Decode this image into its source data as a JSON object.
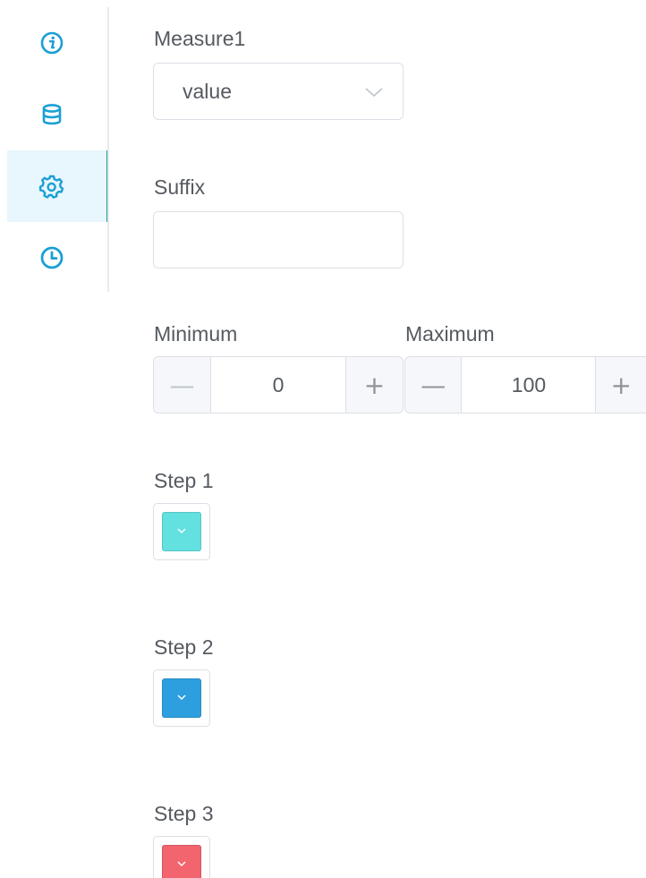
{
  "sidebar": {
    "items": [
      {
        "icon": "info-icon",
        "active": false
      },
      {
        "icon": "database-icon",
        "active": false
      },
      {
        "icon": "gear-icon",
        "active": true
      },
      {
        "icon": "clock-icon",
        "active": false
      }
    ],
    "accent_color": "#1a9fd6",
    "active_bar_color": "#1aa39a"
  },
  "form": {
    "measure_label": "Measure1",
    "measure_value": "value",
    "suffix_label": "Suffix",
    "suffix_value": "",
    "minimum_label": "Minimum",
    "minimum_value": "0",
    "maximum_label": "Maximum",
    "maximum_value": "100",
    "decrement_symbol": "—",
    "increment_symbol": "+",
    "steps": [
      {
        "label": "Step 1",
        "color": "#63e0e0"
      },
      {
        "label": "Step 2",
        "color": "#2d9fdf"
      },
      {
        "label": "Step 3",
        "color": "#f2646e"
      }
    ]
  }
}
